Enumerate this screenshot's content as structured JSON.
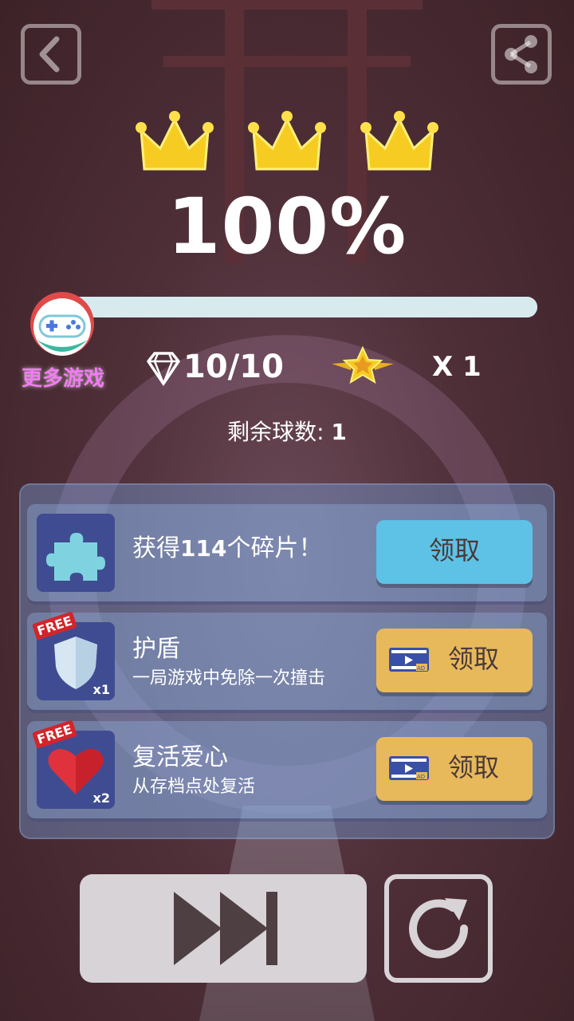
{
  "header": {
    "back_icon": "back-arrow-icon",
    "share_icon": "share-icon"
  },
  "result": {
    "crowns": 3,
    "percent": "100%",
    "progress": 1.0
  },
  "more_games": {
    "label": "更多游戏",
    "icon": "gamepad-icon"
  },
  "stats": {
    "gems": "10/10",
    "stars": "X 1"
  },
  "remaining": {
    "label": "剩余球数:",
    "value": "1"
  },
  "rewards": [
    {
      "title_prefix": "获得",
      "title_number": "114",
      "title_suffix": "个碎片！",
      "icon": "puzzle-icon",
      "claim": "领取"
    },
    {
      "title": "护盾",
      "subtitle": "一局游戏中免除一次撞击",
      "icon": "shield-icon",
      "free": "FREE",
      "multiplier": "x1",
      "claim": "领取"
    },
    {
      "title": "复活爱心",
      "subtitle": "从存档点处复活",
      "icon": "heart-icon",
      "free": "FREE",
      "multiplier": "x2",
      "claim": "领取"
    }
  ],
  "colors": {
    "accent_blue": "#5ec2e6",
    "accent_gold": "#e8b95a",
    "panel_icon_bg": "#3f4c92"
  }
}
